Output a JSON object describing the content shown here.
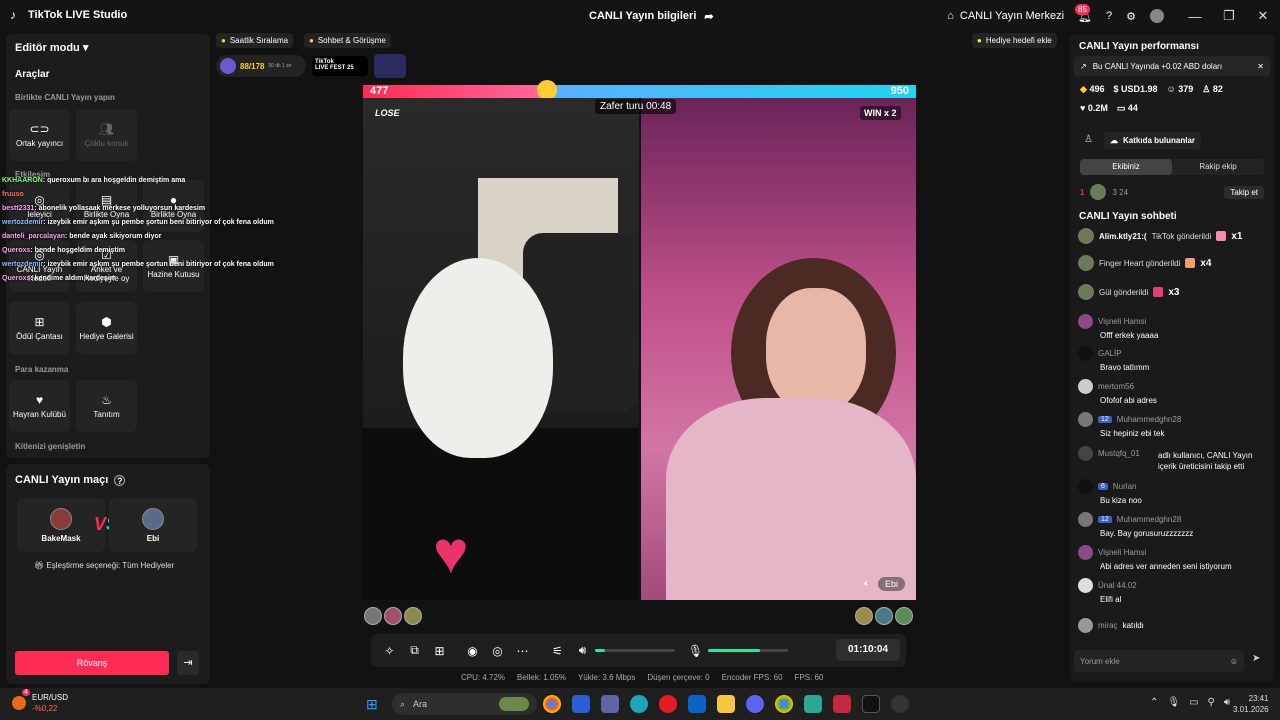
{
  "titlebar": {
    "app_name": "TikTok LIVE Studio",
    "window_title": "CANLI Yayın bilgileri",
    "center_link": "CANLI Yayın Merkezi",
    "notif_count": "85",
    "min": "—",
    "max": "❐",
    "close": "✕"
  },
  "left": {
    "editor_mode": "Editör modu",
    "tools_title": "Araçlar",
    "co_live_title": "Birlikte CANLI Yayın yapın",
    "cohost": "Ortak yayıncı",
    "multi_guest": "Çoklu konuk",
    "interaction_title": "Etkileşim",
    "inviter": "Ieleyici",
    "poll": "Anket ve Hediyeyle oy",
    "watch_together": "Birlikte Oyna",
    "live_gift": "CANLI Yayın Hedefi",
    "treasure": "Hazine Kutusu",
    "reward_bag": "Ödül Çantası",
    "gift_gallery": "Hediye Galerisi",
    "earn_title": "Para kazanma",
    "fan_club": "Hayran Kulübü",
    "promote": "Tanıtım",
    "audience_title": "Kitlenizi genişletin"
  },
  "match": {
    "title": "CANLI Yayın maçı",
    "player1": "BakeMask",
    "player2": "Ebi",
    "vs": "VS",
    "option": "Eşleştirme seçeneği: Tüm Hediyeler",
    "rematch": "Rövanş"
  },
  "overlay_chat": [
    {
      "user": "KKHAARON",
      "text": ": queroxum bı ara hoşgeldin demiştim ama"
    },
    {
      "user": "fruuso",
      "text": ""
    },
    {
      "user": "bestt2331",
      "text": ": abonelik yollasaak merkese yolluyorsun kardesim"
    },
    {
      "user": "wertozdemir",
      "text": ": izeybik emir aşkım şu pembe şortun beni bitiriyor of çok fena oldum"
    },
    {
      "user": "danteli_parcalayan",
      "text": ": bende ayak sikiyorum diyor"
    },
    {
      "user": "Queroxs",
      "text": ": bende hoşgeldim demiştim"
    },
    {
      "user": "wertozdemir",
      "text": ": izeybik emir aşkım şu pembe şortun beni bitiriyor of çok fena oldum"
    },
    {
      "user": "Queroxs",
      "text": ": kendime aldım kardeşim"
    }
  ],
  "top": {
    "hourly": "Saatlik Sıralama",
    "chat_meet": "Sohbet & Görüşme",
    "level": "88/178",
    "level_small": "50 dk 1 sn",
    "fest_line1": "TikTok",
    "fest_line2": "LIVE FEST 25",
    "gift_goal": "Hediye hedefi ekle"
  },
  "battle": {
    "score_left": "477",
    "score_right": "950",
    "lose": "LOSE",
    "win": "WIN x 2",
    "timer": "Zafer turu 00:48",
    "opponent": "Ebi"
  },
  "controls": {
    "elapsed": "01:10:04"
  },
  "status": {
    "cpu": "CPU:  4.72%",
    "memory": "Bellek:  1.05%",
    "upload": "Yükle:  3.6 Mbps",
    "dropped": "Düşen çerçeve:  0",
    "encoder": "Encoder FPS:  60",
    "fps": "FPS:  60"
  },
  "right": {
    "perf_title": "CANLI Yayın performansı",
    "banner": "Bu CANLI Yayında +0.02 ABD doları",
    "coins": "496",
    "usd": "USD1.98",
    "viewers": "379",
    "new_followers": "82",
    "likes": "0.2M",
    "comments": "44",
    "contributors": "Katkıda bulunanlar",
    "tab_ours": "Ekibiniz",
    "tab_theirs": "Rakip ekip",
    "rank1": "1",
    "rank_stats": "3  24",
    "follow": "Takip et",
    "chat_title": "CANLI Yayın sohbeti",
    "gifts": [
      {
        "text": "Alim.ktly21:(",
        "detail": "TikTok gönderildi",
        "mult": "x1"
      },
      {
        "text": "",
        "detail": "Finger Heart gönderildi",
        "mult": "x4"
      },
      {
        "text": "",
        "detail": "Gül gönderildi",
        "mult": "x3"
      }
    ],
    "messages": [
      {
        "user": "Vişneli Hamsi",
        "level": "",
        "text": "Offf erkek yaaaa"
      },
      {
        "user": "GALİP",
        "level": "",
        "text": "Bravo tatlımm"
      },
      {
        "user": "mertom56",
        "level": "",
        "text": "Ofofof abi adres"
      },
      {
        "user": "Muhammedghn28",
        "level": "12",
        "text": "Siz hepiniz ebi tek"
      },
      {
        "user": "Mustqfq_01",
        "level": "",
        "text": "adlı kullanıcı, CANLI Yayın içerik üreticisini takip etti"
      },
      {
        "user": "Nurlan",
        "level": "6",
        "text": "Bu kiza noo"
      },
      {
        "user": "Muhammedghn28",
        "level": "12",
        "text": "Bay. Bay gorusuruzzzzzzz"
      },
      {
        "user": "Vişneli Hamsi",
        "level": "",
        "text": "Abi adres ver anneden seni istiyorum"
      },
      {
        "user": "Ünal 44.02",
        "level": "",
        "text": "Elifi al"
      },
      {
        "user": "miraç",
        "level": "",
        "text": "katıldı"
      }
    ],
    "comment_placeholder": "Yorum ekle"
  },
  "taskbar": {
    "ticker_name": "EUR/USD",
    "ticker_change": "-%0,22",
    "ticker_badge": "4",
    "search": "Ara",
    "time": "23:41",
    "date": "3.01.2026"
  },
  "colors": {
    "accent": "#fe2c55",
    "cyan": "#20d5ec",
    "bg": "#121212",
    "panel": "#1c1c1c"
  }
}
